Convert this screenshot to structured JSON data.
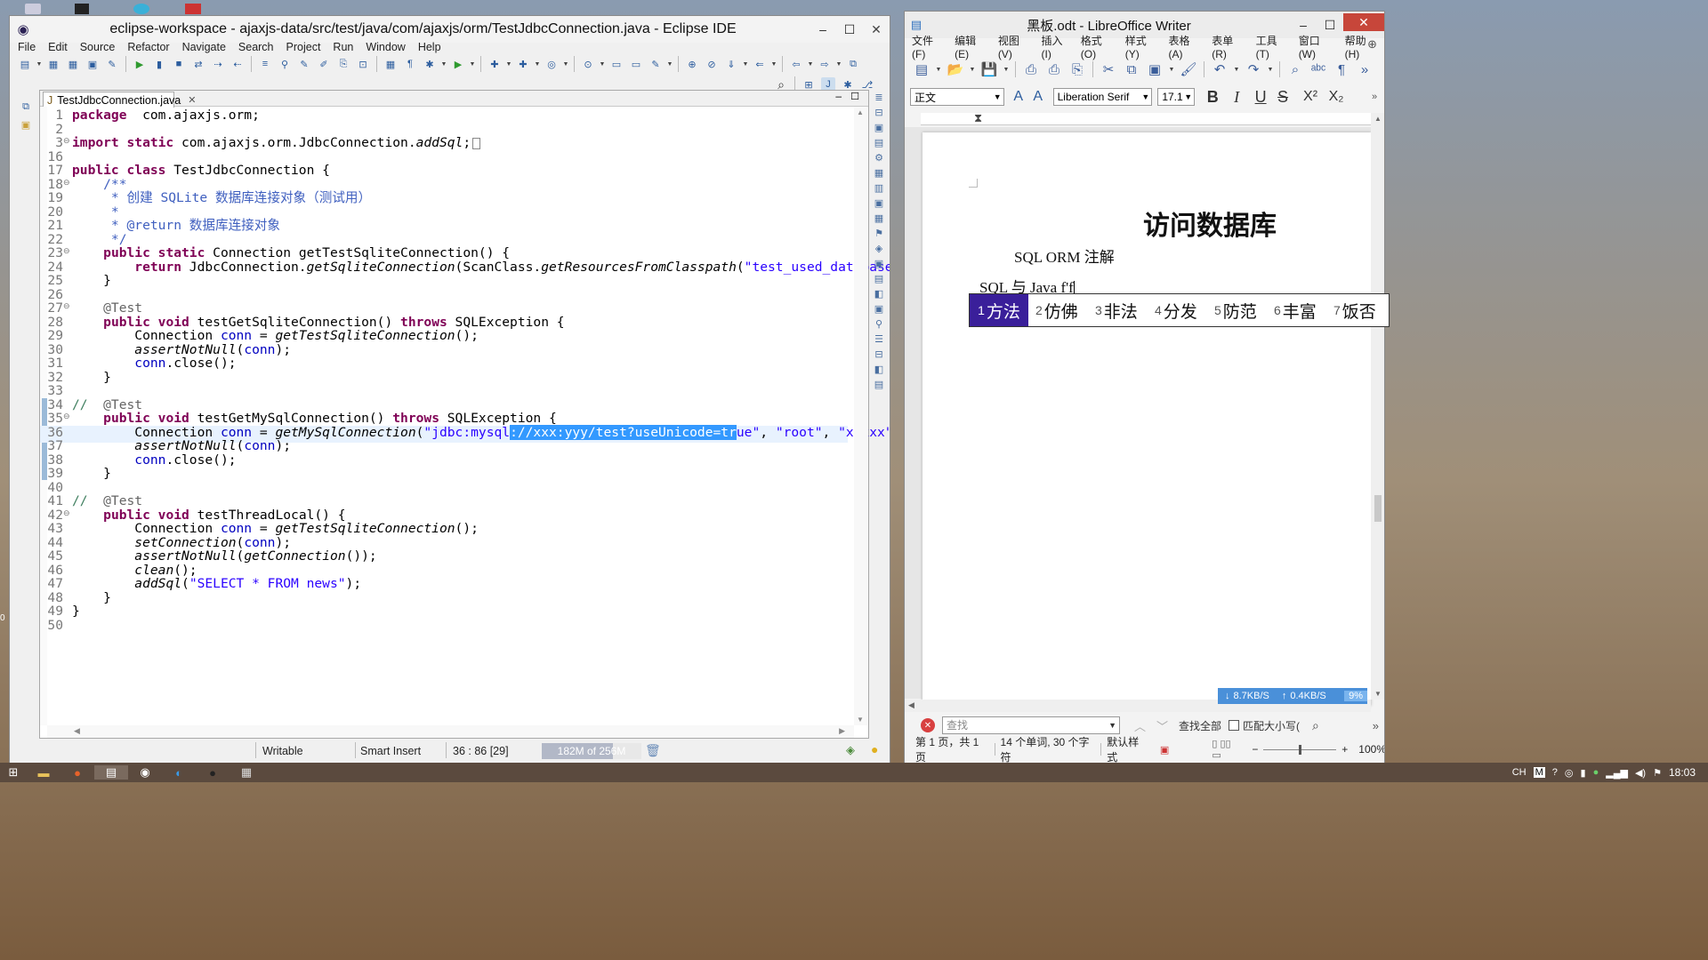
{
  "desktop": {
    "icons": [
      "app-icon-1",
      "app-icon-2",
      "app-icon-3"
    ]
  },
  "eclipse": {
    "title": "eclipse-workspace - ajaxjs-data/src/test/java/com/ajaxjs/orm/TestJdbcConnection.java - Eclipse IDE",
    "menu": [
      "File",
      "Edit",
      "Source",
      "Refactor",
      "Navigate",
      "Search",
      "Project",
      "Run",
      "Window",
      "Help"
    ],
    "tab_label": "TestJdbcConnection.java",
    "status": {
      "mode": "Writable",
      "insert": "Smart Insert",
      "position": "36 : 86 [29]",
      "heap": "182M of 256M",
      "heap_fraction": 0.71
    },
    "lines": [
      {
        "n": "1",
        "segs": [
          [
            "kw",
            "package"
          ],
          [
            "",
            "  com.ajaxjs.orm;"
          ]
        ]
      },
      {
        "n": "2",
        "segs": []
      },
      {
        "n": "3",
        "fold": true,
        "segs": [
          [
            "kw",
            "import static"
          ],
          [
            "",
            " com.ajaxjs.orm.JdbcConnection."
          ],
          [
            "it",
            "addSql"
          ],
          [
            "",
            ";"
          ]
        ]
      },
      {
        "n": "16",
        "segs": []
      },
      {
        "n": "17",
        "segs": [
          [
            "kw",
            "public class"
          ],
          [
            "",
            " TestJdbcConnection {"
          ]
        ]
      },
      {
        "n": "18",
        "fold": true,
        "segs": [
          [
            "cm",
            "    /**"
          ]
        ]
      },
      {
        "n": "19",
        "segs": [
          [
            "cm",
            "     * 创建 SQLite 数据库连接对象（测试用）"
          ]
        ]
      },
      {
        "n": "20",
        "segs": [
          [
            "cm",
            "     *"
          ]
        ]
      },
      {
        "n": "21",
        "segs": [
          [
            "cm",
            "     * @return 数据库连接对象"
          ]
        ]
      },
      {
        "n": "22",
        "segs": [
          [
            "cm",
            "     */"
          ]
        ]
      },
      {
        "n": "23",
        "fold": true,
        "segs": [
          [
            "",
            "    "
          ],
          [
            "kw",
            "public static"
          ],
          [
            "",
            " Connection getTestSqliteConnection() {"
          ]
        ]
      },
      {
        "n": "24",
        "segs": [
          [
            "",
            "        "
          ],
          [
            "kw",
            "return"
          ],
          [
            "",
            " JdbcConnection."
          ],
          [
            "it",
            "getSqliteConnection"
          ],
          [
            "",
            "(ScanClass."
          ],
          [
            "it",
            "getResourcesFromClasspath"
          ],
          [
            "",
            "("
          ],
          [
            "str",
            "\"test_used_database.sqlite\""
          ],
          [
            "",
            "));"
          ]
        ]
      },
      {
        "n": "25",
        "segs": [
          [
            "",
            "    }"
          ]
        ]
      },
      {
        "n": "26",
        "segs": []
      },
      {
        "n": "27",
        "fold": true,
        "segs": [
          [
            "an",
            "    @Test"
          ]
        ]
      },
      {
        "n": "28",
        "segs": [
          [
            "",
            "    "
          ],
          [
            "kw",
            "public void"
          ],
          [
            "",
            " testGetSqliteConnection() "
          ],
          [
            "kw",
            "throws"
          ],
          [
            "",
            " SQLException {"
          ]
        ]
      },
      {
        "n": "29",
        "segs": [
          [
            "",
            "        Connection "
          ],
          [
            "fld",
            "conn"
          ],
          [
            "",
            " = "
          ],
          [
            "it",
            "getTestSqliteConnection"
          ],
          [
            "",
            "();"
          ]
        ]
      },
      {
        "n": "30",
        "segs": [
          [
            "",
            "        "
          ],
          [
            "it",
            "assertNotNull"
          ],
          [
            "",
            "("
          ],
          [
            "fld",
            "conn"
          ],
          [
            "",
            ");"
          ]
        ]
      },
      {
        "n": "31",
        "segs": [
          [
            "",
            "        "
          ],
          [
            "fld",
            "conn"
          ],
          [
            "",
            ".close();"
          ]
        ]
      },
      {
        "n": "32",
        "segs": [
          [
            "",
            "    }"
          ]
        ]
      },
      {
        "n": "33",
        "segs": []
      },
      {
        "n": "34",
        "segs": [
          [
            "cmt",
            "//"
          ],
          [
            "an",
            "  @Test"
          ]
        ]
      },
      {
        "n": "35",
        "fold": true,
        "segs": [
          [
            "",
            "    "
          ],
          [
            "kw",
            "public void"
          ],
          [
            "",
            " testGetMySqlConnection() "
          ],
          [
            "kw",
            "throws"
          ],
          [
            "",
            " SQLException {"
          ]
        ]
      },
      {
        "n": "36",
        "current": true,
        "segs": [
          [
            "",
            "        Connection "
          ],
          [
            "fld",
            "conn"
          ],
          [
            "",
            " = "
          ],
          [
            "it",
            "getMySqlConnection"
          ],
          [
            "",
            "("
          ],
          [
            "str",
            "\"jdbc:mysql"
          ],
          [
            "sel",
            "://xxx:yyy/test?useUnicode=tr"
          ],
          [
            "str",
            "ue\""
          ],
          [
            "",
            ", "
          ],
          [
            "str",
            "\"root\""
          ],
          [
            "",
            ", "
          ],
          [
            "str",
            "\"xxxxx\""
          ],
          [
            "",
            ");"
          ]
        ]
      },
      {
        "n": "37",
        "segs": [
          [
            "",
            "        "
          ],
          [
            "it",
            "assertNotNull"
          ],
          [
            "",
            "("
          ],
          [
            "fld",
            "conn"
          ],
          [
            "",
            ");"
          ]
        ]
      },
      {
        "n": "38",
        "segs": [
          [
            "",
            "        "
          ],
          [
            "fld",
            "conn"
          ],
          [
            "",
            ".close();"
          ]
        ]
      },
      {
        "n": "39",
        "segs": [
          [
            "",
            "    }"
          ]
        ]
      },
      {
        "n": "40",
        "segs": []
      },
      {
        "n": "41",
        "segs": [
          [
            "cmt",
            "//"
          ],
          [
            "an",
            "  @Test"
          ]
        ]
      },
      {
        "n": "42",
        "fold": true,
        "segs": [
          [
            "",
            "    "
          ],
          [
            "kw",
            "public void"
          ],
          [
            "",
            " testThreadLocal() {"
          ]
        ]
      },
      {
        "n": "43",
        "segs": [
          [
            "",
            "        Connection "
          ],
          [
            "fld",
            "conn"
          ],
          [
            "",
            " = "
          ],
          [
            "it",
            "getTestSqliteConnection"
          ],
          [
            "",
            "();"
          ]
        ]
      },
      {
        "n": "44",
        "segs": [
          [
            "",
            "        "
          ],
          [
            "it",
            "setConnection"
          ],
          [
            "",
            "("
          ],
          [
            "fld",
            "conn"
          ],
          [
            "",
            ");"
          ]
        ]
      },
      {
        "n": "45",
        "segs": [
          [
            "",
            "        "
          ],
          [
            "it",
            "assertNotNull"
          ],
          [
            "",
            "("
          ],
          [
            "it",
            "getConnection"
          ],
          [
            "",
            "());"
          ]
        ]
      },
      {
        "n": "46",
        "segs": [
          [
            "",
            "        "
          ],
          [
            "it",
            "clean"
          ],
          [
            "",
            "();"
          ]
        ]
      },
      {
        "n": "47",
        "segs": [
          [
            "",
            "        "
          ],
          [
            "it",
            "addSql"
          ],
          [
            "",
            "("
          ],
          [
            "str",
            "\"SELECT * FROM news\""
          ],
          [
            "",
            ");"
          ]
        ]
      },
      {
        "n": "48",
        "segs": [
          [
            "",
            "    }"
          ]
        ]
      },
      {
        "n": "49",
        "segs": [
          [
            "",
            "}"
          ]
        ]
      },
      {
        "n": "50",
        "segs": []
      }
    ]
  },
  "writer": {
    "title": "黑板.odt - LibreOffice Writer",
    "menu": [
      "文件(F)",
      "编辑(E)",
      "视图(V)",
      "插入(I)",
      "格式(O)",
      "样式(Y)",
      "表格(A)",
      "表单(R)",
      "工具(T)",
      "窗口(W)",
      "帮助(H)"
    ],
    "para_style": "正文",
    "font_name": "Liberation Serif",
    "font_size": "17.1",
    "doc_heading": "访问数据库",
    "doc_line1": "SQL ORM 注解",
    "doc_line2": "SQL 与 Java f'f",
    "find_placeholder": "查找",
    "find_all": "查找全部",
    "match_case": "匹配大小写(",
    "status": {
      "page": "第 1 页，共 1 页",
      "words": "14 个单词, 30 个字符",
      "style": "默认样式",
      "zoom": "100%"
    },
    "net": {
      "down": "8.7KB/S",
      "up": "0.4KB/S",
      "cpu": "9%"
    }
  },
  "ime": {
    "candidates": [
      [
        "1",
        "方法"
      ],
      [
        "2",
        "仿佛"
      ],
      [
        "3",
        "非法"
      ],
      [
        "4",
        "分发"
      ],
      [
        "5",
        "防范"
      ],
      [
        "6",
        "丰富"
      ],
      [
        "7",
        "饭否"
      ]
    ]
  },
  "taskbar": {
    "clock": "18:03",
    "lang": "CH"
  },
  "colors": {
    "selection": "#3399ff",
    "ime_selected": "#3a1f9a",
    "current_line": "#e8f2fe"
  }
}
